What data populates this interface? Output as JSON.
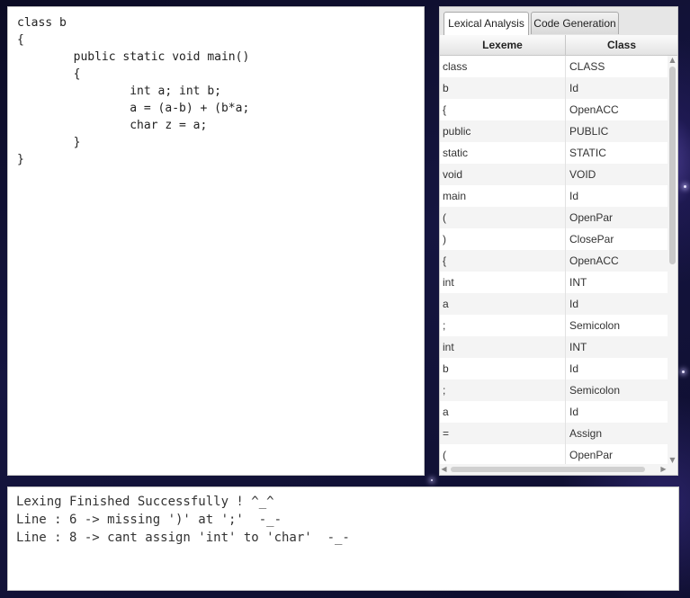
{
  "editor": {
    "code": "class b\n{\n        public static void main()\n        {\n                int a; int b;\n                a = (a-b) + (b*a;\n                char z = a;\n        }\n}"
  },
  "tabs": [
    {
      "label": "Lexical Analysis",
      "active": true
    },
    {
      "label": "Code Generation",
      "active": false
    }
  ],
  "table": {
    "columns": [
      "Lexeme",
      "Class"
    ],
    "rows": [
      [
        "class",
        "CLASS"
      ],
      [
        "b",
        "Id"
      ],
      [
        "{",
        "OpenACC"
      ],
      [
        "public",
        "PUBLIC"
      ],
      [
        "static",
        "STATIC"
      ],
      [
        "void",
        "VOID"
      ],
      [
        "main",
        "Id"
      ],
      [
        "(",
        "OpenPar"
      ],
      [
        ")",
        "ClosePar"
      ],
      [
        "{",
        "OpenACC"
      ],
      [
        "int",
        "INT"
      ],
      [
        "a",
        "Id"
      ],
      [
        ";",
        "Semicolon"
      ],
      [
        "int",
        "INT"
      ],
      [
        "b",
        "Id"
      ],
      [
        ";",
        "Semicolon"
      ],
      [
        "a",
        "Id"
      ],
      [
        "=",
        "Assign"
      ],
      [
        "(",
        "OpenPar"
      ]
    ]
  },
  "console": {
    "lines": [
      "Lexing Finished Successfully ! ^_^",
      "Line : 6 -> missing ')' at ';'  -_-",
      "Line : 8 -> cant assign 'int' to 'char'  -_-"
    ]
  },
  "icons": {
    "scroll_up": "arrow-up-icon",
    "scroll_down": "arrow-down-icon",
    "scroll_left": "arrow-left-icon",
    "scroll_right": "arrow-right-icon"
  }
}
